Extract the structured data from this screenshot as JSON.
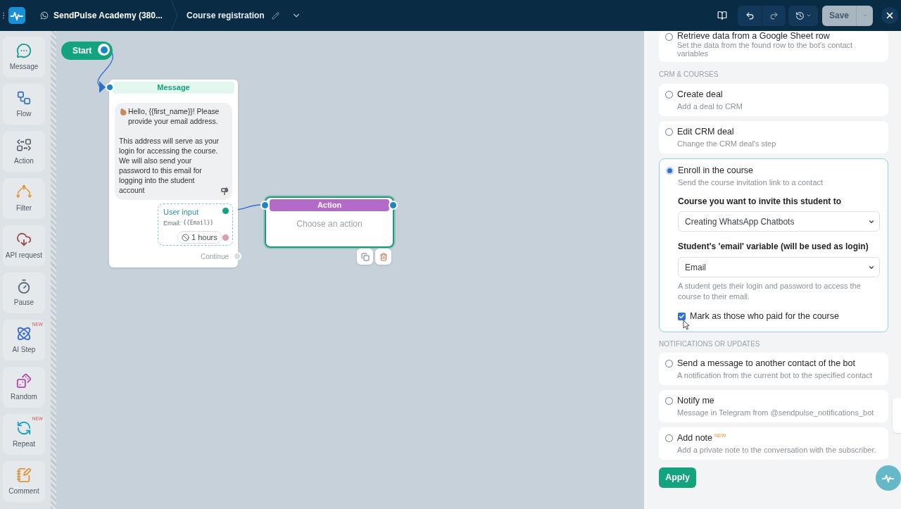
{
  "top_bar": {
    "bot_name": "SendPulse Academy (380...",
    "flow_name": "Course registration",
    "save_label": "Save"
  },
  "sidebar": {
    "items": [
      {
        "kind": "message",
        "label": "Message"
      },
      {
        "kind": "flow",
        "label": "Flow"
      },
      {
        "kind": "action",
        "label": "Action"
      },
      {
        "kind": "filter",
        "label": "Filter"
      },
      {
        "kind": "api",
        "label": "API request"
      },
      {
        "kind": "pause",
        "label": "Pause"
      },
      {
        "kind": "ai",
        "label": "AI Step",
        "badge": "NEW"
      },
      {
        "kind": "random",
        "label": "Random"
      },
      {
        "kind": "repeat",
        "label": "Repeat",
        "badge": "NEW"
      },
      {
        "kind": "comment",
        "label": "Comment"
      }
    ]
  },
  "canvas": {
    "start_node": {
      "label": "Start"
    },
    "message_node": {
      "title": "Message",
      "paragraphs": [
        "Hello, {{first_name}}! Please provide your email address.",
        "This address will serve as your login for accessing the course. We will also send your password to this email for logging into the student account"
      ],
      "user_input": {
        "title": "User input",
        "field_label": "Email:",
        "variable": "{{Email}}",
        "timeout": "1 hours"
      },
      "continue_label": "Continue"
    },
    "action_node": {
      "title": "Action",
      "prompt": "Choose an action",
      "selected": true
    }
  },
  "panel": {
    "sections": [
      {
        "options": [
          {
            "title": "Retrieve data from a Google Sheet row",
            "description": "Set the data from the found row to the bot's contact variables",
            "selected": false
          }
        ]
      },
      {
        "heading": "CRM & COURSES",
        "options": [
          {
            "title": "Create deal",
            "description": "Add a deal to CRM",
            "selected": false
          },
          {
            "title": "Edit CRM deal",
            "description": "Change the CRM deal's step",
            "selected": false
          },
          {
            "title": "Enroll in the course",
            "description": "Send the course invitation link to a contact",
            "selected": true,
            "settings": {
              "course_label": "Course you want to invite this student to",
              "course_value": "Creating WhatsApp Chatbots",
              "email_label": "Student's 'email' variable (will be used as login)",
              "email_value": "Email",
              "hint": "A student gets their login and password to access the course to their email.",
              "paid_checkbox": {
                "label": "Mark as those who paid for the course",
                "checked": true
              }
            }
          }
        ]
      },
      {
        "heading": "NOTIFICATIONS OR UPDATES",
        "options": [
          {
            "title": "Send a message to another contact of the bot",
            "description": "A notification from the current bot to the specified contact",
            "selected": false
          },
          {
            "title": "Notify me",
            "description": "Message in Telegram from @sendpulse_notifications_bot",
            "selected": false
          },
          {
            "title": "Add note",
            "badge": "NEW",
            "description": "Add a private note to the conversation with the subscriber.",
            "selected": false
          }
        ]
      }
    ],
    "apply_label": "Apply"
  }
}
